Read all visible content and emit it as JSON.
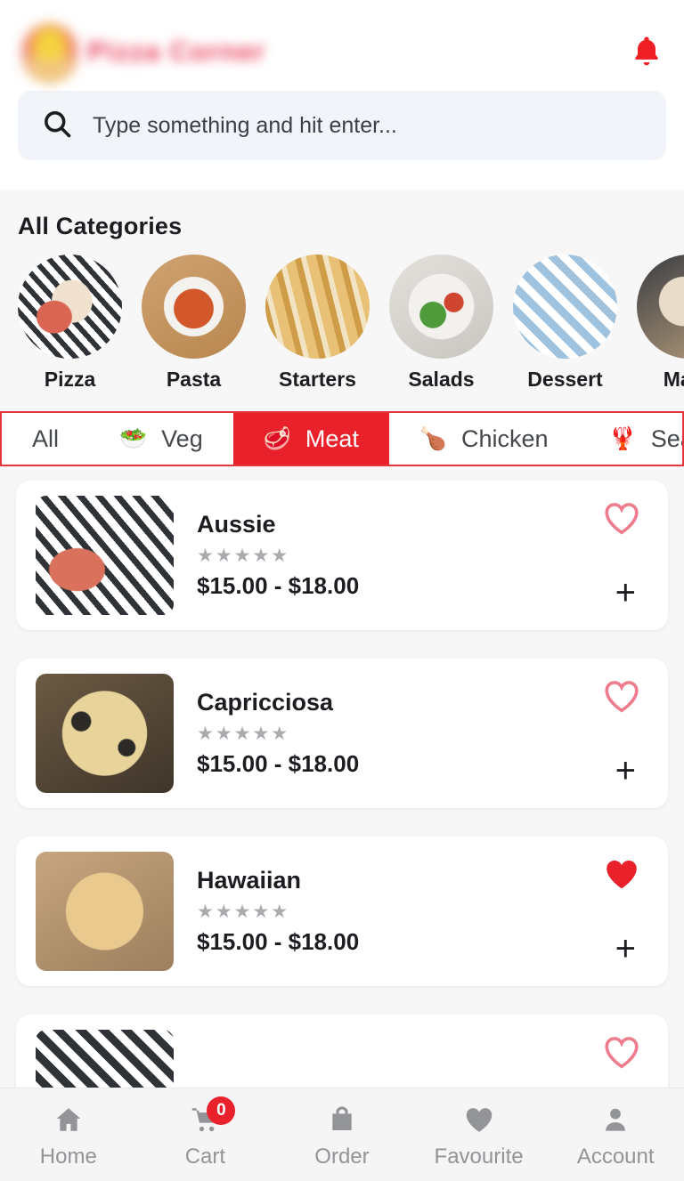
{
  "header": {
    "logo_icon": "app-logo-blurred",
    "brand_name": "",
    "notification_icon": "bell-icon"
  },
  "search": {
    "icon": "search-icon",
    "placeholder": "Type something and hit enter...",
    "value": ""
  },
  "categories": {
    "title": "All Categories",
    "items": [
      {
        "label": "Pizza",
        "img_class": "c-pizza"
      },
      {
        "label": "Pasta",
        "img_class": "c-pasta"
      },
      {
        "label": "Starters",
        "img_class": "c-starters"
      },
      {
        "label": "Salads",
        "img_class": "c-salads"
      },
      {
        "label": "Dessert",
        "img_class": "c-dessert"
      },
      {
        "label": "Make",
        "img_class": "c-make"
      }
    ]
  },
  "filter_tabs": {
    "selected": "Meat",
    "items": [
      {
        "label": "All",
        "emoji": ""
      },
      {
        "label": "Veg",
        "emoji": "🥗"
      },
      {
        "label": "Meat",
        "emoji": "🥩"
      },
      {
        "label": "Chicken",
        "emoji": "🍗"
      },
      {
        "label": "Sea",
        "emoji": "🦞"
      }
    ]
  },
  "products": [
    {
      "name": "Aussie",
      "rating_stars": "★★★★★",
      "price": "$15.00 - $18.00",
      "favourite": false,
      "add_label": "+",
      "thumb_class": "t-aussie"
    },
    {
      "name": "Capricciosa",
      "rating_stars": "★★★★★",
      "price": "$15.00 - $18.00",
      "favourite": false,
      "add_label": "+",
      "thumb_class": "t-capricciosa"
    },
    {
      "name": "Hawaiian",
      "rating_stars": "★★★★★",
      "price": "$15.00 - $18.00",
      "favourite": true,
      "add_label": "+",
      "thumb_class": "t-hawaiian"
    },
    {
      "name": "",
      "rating_stars": "",
      "price": "",
      "favourite": false,
      "add_label": "",
      "thumb_class": "t-peek"
    }
  ],
  "bottom_nav": {
    "items": [
      {
        "label": "Home",
        "icon": "home-icon"
      },
      {
        "label": "Cart",
        "icon": "cart-icon",
        "badge": "0"
      },
      {
        "label": "Order",
        "icon": "bag-icon"
      },
      {
        "label": "Favourite",
        "icon": "heart-icon"
      },
      {
        "label": "Account",
        "icon": "person-icon"
      }
    ]
  },
  "colors": {
    "accent_red": "#E8212A",
    "heart_outline": "#EE7C8E",
    "heart_filled": "#E8212A",
    "nav_gray": "#929498",
    "search_bg": "#F1F4F9"
  }
}
